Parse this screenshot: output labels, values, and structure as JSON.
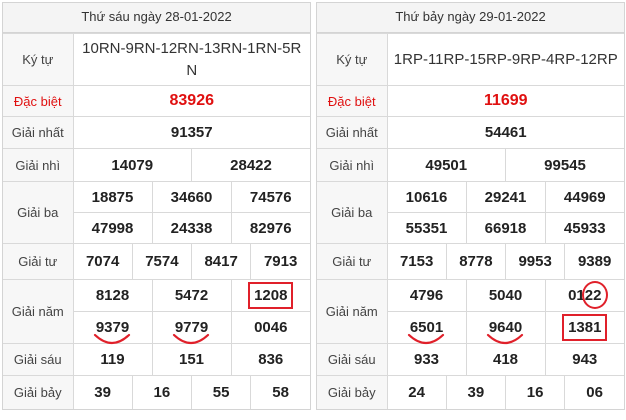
{
  "accent_red": "#e01010",
  "left": {
    "title": "Thứ sáu ngày 28-01-2022",
    "kytu_label": "Ký tự",
    "kytu_value": "10RN-9RN-12RN-13RN-1RN-5RN",
    "db_label": "Đặc biệt",
    "db": "83926",
    "g1_label": "Giải nhất",
    "g1": "91357",
    "g2_label": "Giải nhì",
    "g2": [
      "14079",
      "28422"
    ],
    "g3_label": "Giải ba",
    "g3": [
      "18875",
      "34660",
      "74576",
      "47998",
      "24338",
      "82976"
    ],
    "g4_label": "Giải tư",
    "g4": [
      "7074",
      "7574",
      "8417",
      "7913"
    ],
    "g5_label": "Giải năm",
    "g5": [
      "8128",
      "5472",
      "1208",
      "9379",
      "9779",
      "0046"
    ],
    "g6_label": "Giải sáu",
    "g6": [
      "119",
      "151",
      "836"
    ],
    "g7_label": "Giải bảy",
    "g7": [
      "39",
      "16",
      "55",
      "58"
    ]
  },
  "right": {
    "title": "Thứ bảy ngày 29-01-2022",
    "kytu_label": "Ký tự",
    "kytu_value": "1RP-11RP-15RP-9RP-4RP-12RP",
    "db_label": "Đặc biệt",
    "db": "11699",
    "g1_label": "Giải nhất",
    "g1": "54461",
    "g2_label": "Giải nhì",
    "g2": [
      "49501",
      "99545"
    ],
    "g3_label": "Giải ba",
    "g3": [
      "10616",
      "29241",
      "44969",
      "55351",
      "66918",
      "45933"
    ],
    "g4_label": "Giải tư",
    "g4": [
      "7153",
      "8778",
      "9953",
      "9389"
    ],
    "g5_label": "Giải năm",
    "g5": [
      "4796",
      "5040",
      "0122",
      "6501",
      "9640",
      "1381"
    ],
    "g6_label": "Giải sáu",
    "g6": [
      "933",
      "418",
      "943"
    ],
    "g7_label": "Giải bảy",
    "g7": [
      "24",
      "39",
      "16",
      "06"
    ]
  }
}
